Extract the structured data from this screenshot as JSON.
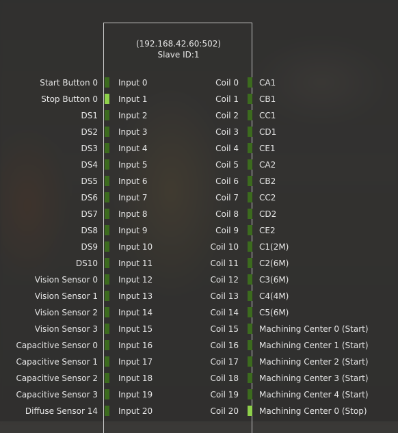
{
  "device": {
    "address": "(192.168.42.60:502)",
    "slave_id": "Slave ID:1"
  },
  "colors": {
    "indicator_off": "#3c6b1e",
    "indicator_on": "#8ed04a"
  },
  "rows": [
    {
      "input_label": "Start Button 0",
      "input": "Input 0",
      "input_on": false,
      "coil": "Coil 0",
      "coil_label": "CA1",
      "coil_on": false
    },
    {
      "input_label": "Stop Button 0",
      "input": "Input 1",
      "input_on": true,
      "coil": "Coil 1",
      "coil_label": "CB1",
      "coil_on": false
    },
    {
      "input_label": "DS1",
      "input": "Input 2",
      "input_on": false,
      "coil": "Coil 2",
      "coil_label": "CC1",
      "coil_on": false
    },
    {
      "input_label": "DS2",
      "input": "Input 3",
      "input_on": false,
      "coil": "Coil 3",
      "coil_label": "CD1",
      "coil_on": false
    },
    {
      "input_label": "DS3",
      "input": "Input 4",
      "input_on": false,
      "coil": "Coil 4",
      "coil_label": "CE1",
      "coil_on": false
    },
    {
      "input_label": "DS4",
      "input": "Input 5",
      "input_on": false,
      "coil": "Coil 5",
      "coil_label": "CA2",
      "coil_on": false
    },
    {
      "input_label": "DS5",
      "input": "Input 6",
      "input_on": false,
      "coil": "Coil 6",
      "coil_label": "CB2",
      "coil_on": false
    },
    {
      "input_label": "DS6",
      "input": "Input 7",
      "input_on": false,
      "coil": "Coil 7",
      "coil_label": "CC2",
      "coil_on": false
    },
    {
      "input_label": "DS7",
      "input": "Input 8",
      "input_on": false,
      "coil": "Coil 8",
      "coil_label": "CD2",
      "coil_on": false
    },
    {
      "input_label": "DS8",
      "input": "Input 9",
      "input_on": false,
      "coil": "Coil 9",
      "coil_label": "CE2",
      "coil_on": false
    },
    {
      "input_label": "DS9",
      "input": "Input 10",
      "input_on": false,
      "coil": "Coil 10",
      "coil_label": "C1(2M)",
      "coil_on": false
    },
    {
      "input_label": "DS10",
      "input": "Input 11",
      "input_on": false,
      "coil": "Coil 11",
      "coil_label": "C2(6M)",
      "coil_on": false
    },
    {
      "input_label": "Vision Sensor 0",
      "input": "Input 12",
      "input_on": false,
      "coil": "Coil 12",
      "coil_label": "C3(6M)",
      "coil_on": false
    },
    {
      "input_label": "Vision Sensor 1",
      "input": "Input 13",
      "input_on": false,
      "coil": "Coil 13",
      "coil_label": "C4(4M)",
      "coil_on": false
    },
    {
      "input_label": "Vision Sensor 2",
      "input": "Input 14",
      "input_on": false,
      "coil": "Coil 14",
      "coil_label": "C5(6M)",
      "coil_on": false
    },
    {
      "input_label": "Vision Sensor 3",
      "input": "Input 15",
      "input_on": false,
      "coil": "Coil 15",
      "coil_label": "Machining Center 0 (Start)",
      "coil_on": false
    },
    {
      "input_label": "Capacitive Sensor 0",
      "input": "Input 16",
      "input_on": false,
      "coil": "Coil 16",
      "coil_label": "Machining Center 1 (Start)",
      "coil_on": false
    },
    {
      "input_label": "Capacitive Sensor 1",
      "input": "Input 17",
      "input_on": false,
      "coil": "Coil 17",
      "coil_label": "Machining Center 2 (Start)",
      "coil_on": false
    },
    {
      "input_label": "Capacitive Sensor 2",
      "input": "Input 18",
      "input_on": false,
      "coil": "Coil 18",
      "coil_label": "Machining Center 3 (Start)",
      "coil_on": false
    },
    {
      "input_label": "Capacitive Sensor 3",
      "input": "Input 19",
      "input_on": false,
      "coil": "Coil 19",
      "coil_label": "Machining Center 4 (Start)",
      "coil_on": false
    },
    {
      "input_label": "Diffuse Sensor 14",
      "input": "Input 20",
      "input_on": false,
      "coil": "Coil 20",
      "coil_label": "Machining Center 0 (Stop)",
      "coil_on": true
    }
  ]
}
